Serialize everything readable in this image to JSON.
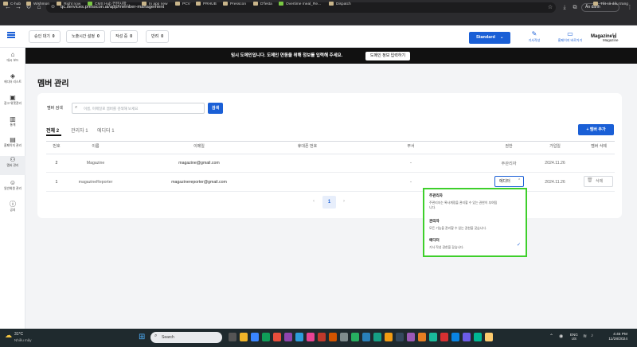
{
  "browser": {
    "url": "qc.services.presscon.ai/app/member-management",
    "profile_label": "Ấn danh",
    "bookmarks": [
      "C-hub",
      "Wishmon",
      "Right now",
      "CMS Hub 컨텐사항...",
      "In app new",
      "PCV",
      "PRHUB",
      "Presscon",
      "D'festa",
      "Overtime meal_Re...",
      "Dispatch"
    ],
    "all_bookmarks": "Tất cả dấu trang"
  },
  "header": {
    "stats": [
      {
        "label": "승인 대기",
        "value": "0"
      },
      {
        "label": "노출시간 설정",
        "value": "0"
      },
      {
        "label": "작성 중",
        "value": "0"
      },
      {
        "label": "반려",
        "value": "0"
      }
    ],
    "plan_label": "Standard",
    "tool_write": "기사작성",
    "tool_homepage": "홈페이지 바로가기",
    "mag_name": "Magazine님",
    "mag_sub": "Magazine"
  },
  "sidebar": {
    "items": [
      {
        "label": "대시 보드",
        "icon": "home-icon"
      },
      {
        "label": "에디터 리스트",
        "icon": "layers-icon"
      },
      {
        "label": "광고 위젯관리",
        "icon": "ad-icon"
      },
      {
        "label": "통계",
        "icon": "chart-icon"
      },
      {
        "label": "홈페이지 관리",
        "icon": "building-icon"
      },
      {
        "label": "멤버 관리",
        "icon": "members-icon"
      },
      {
        "label": "일반회원 관리",
        "icon": "person-icon"
      },
      {
        "label": "공지",
        "icon": "info-icon"
      }
    ]
  },
  "notice": {
    "text": "임시 도메인입니다. 도메인 연동을 위해 정보를 입력해 주세요.",
    "button": "도메인 정보 입력하기"
  },
  "main": {
    "title": "멤버 관리",
    "search_label": "멤버 검색",
    "search_placeholder": "이름, 이메일로 멤버를 검색해 보세요",
    "search_button": "검색",
    "tabs": [
      "전체 2",
      "관리자 1",
      "에디터 1"
    ],
    "add_member": "멤버 추가",
    "columns": [
      "번호",
      "이름",
      "이메일",
      "휴대폰 번호",
      "부서",
      "권한",
      "가입일",
      "멤버 삭제"
    ],
    "rows": [
      {
        "no": "2",
        "name": "Magazine",
        "email": "magazine@gmail.com",
        "phone": "",
        "dept": "-",
        "role": "주관리자",
        "joined": "2024.11.26",
        "delete": ""
      },
      {
        "no": "1",
        "name": "magazineReporter",
        "email": "magazinereporter@gmail.com",
        "phone": "",
        "dept": "-",
        "role": "에디터",
        "joined": "2024.11.26",
        "delete": "삭제"
      }
    ],
    "pagination": {
      "prev": "‹",
      "current": "1",
      "next": "›"
    }
  },
  "dropdown": {
    "options": [
      {
        "title": "주관리자",
        "desc_lines": [
          "주관리자는 록사계정을 관리할 수 있는 권한이 부여됩",
          "니다."
        ]
      },
      {
        "title": "관리자",
        "desc_lines": [
          "모든 기능을 관리할 수 있는 권한을 갖습니다."
        ]
      },
      {
        "title": "에디터",
        "desc_lines": [
          "기사 작성 권한을 갖습니다."
        ]
      }
    ]
  },
  "taskbar": {
    "temp": "31°C",
    "weather": "Nhiều mây",
    "search": "Search",
    "lang_1": "ENG",
    "lang_2": "US",
    "time": "4:45 PM",
    "date": "11/28/2024"
  },
  "colors": {
    "accent": "#1a5fd6",
    "highlight": "#3ecf2b",
    "notice_bg": "#111111"
  }
}
